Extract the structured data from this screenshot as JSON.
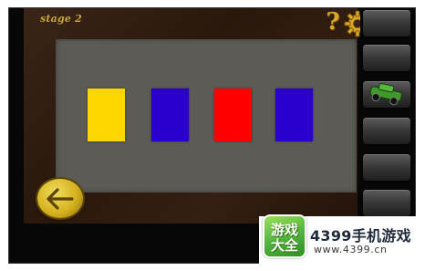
{
  "game": {
    "stage_label": "stage 2",
    "help_symbol": "?"
  },
  "icons": {
    "help": "question-mark-icon",
    "settings": "gear-icon",
    "back": "back-arrow-icon",
    "inventory_item": "green-car-icon"
  },
  "colors": {
    "board": "#2e1b0f",
    "panel": "#5c5b55",
    "accent_gold": "#d8a826"
  },
  "tiles": [
    {
      "color": "#ffd700"
    },
    {
      "color": "#2a00d0"
    },
    {
      "color": "#ff0000"
    },
    {
      "color": "#2a00d0"
    }
  ],
  "inventory": {
    "slots": 7,
    "filled_slot_index": 2
  },
  "watermark": {
    "logo_line1": "游戏",
    "logo_line2": "大全",
    "title": "4399手机游戏",
    "url": "www.4399.cn"
  }
}
